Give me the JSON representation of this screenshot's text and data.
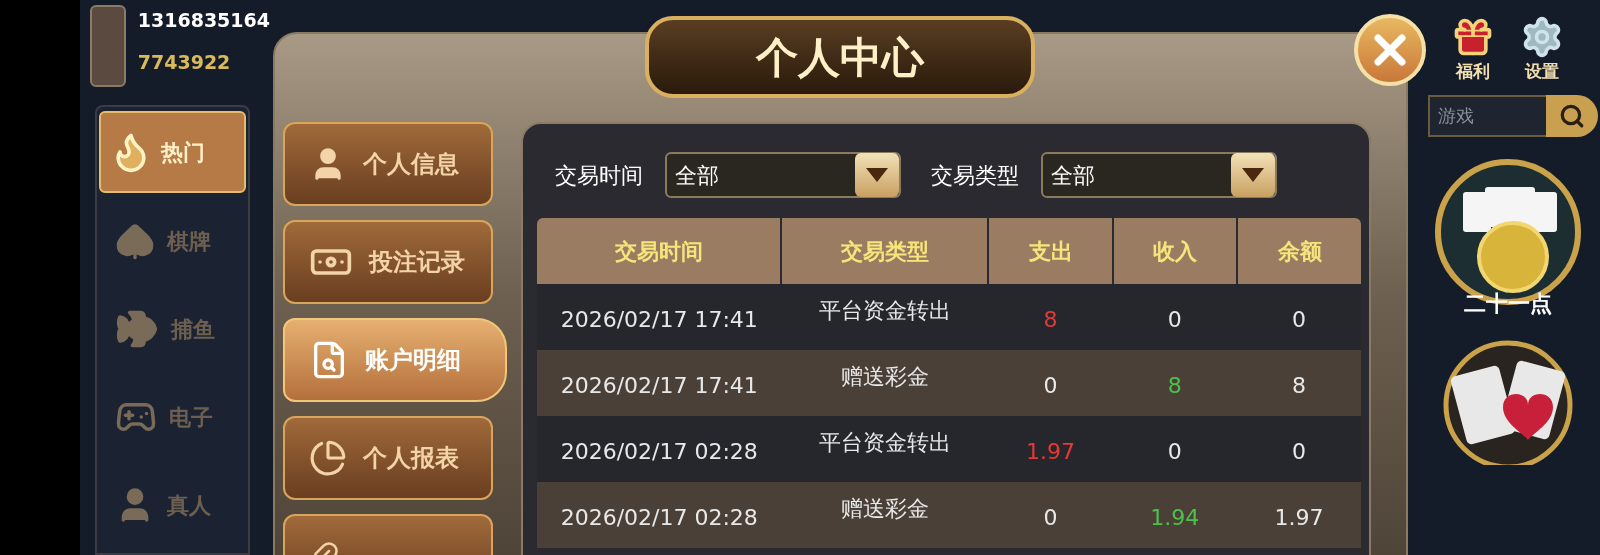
{
  "profile": {
    "phone": "1316835164",
    "balance": "7743922"
  },
  "categories": [
    {
      "label": "热门",
      "kind": "hot",
      "selected": true
    },
    {
      "label": "棋牌",
      "kind": "cards",
      "selected": false
    },
    {
      "label": "捕鱼",
      "kind": "fish",
      "selected": false
    },
    {
      "label": "电子",
      "kind": "slot",
      "selected": false
    },
    {
      "label": "真人",
      "kind": "live",
      "selected": false
    }
  ],
  "top_icons": [
    {
      "label": "福利",
      "kind": "gift"
    },
    {
      "label": "设置",
      "kind": "settings"
    }
  ],
  "search": {
    "placeholder": "游戏"
  },
  "games": [
    {
      "label": "二十一点",
      "kind": "blackjack"
    },
    {
      "kind": "redblack"
    }
  ],
  "dialog": {
    "title": "个人中心",
    "tabs": [
      {
        "label": "个人信息",
        "kind": "info",
        "selected": false
      },
      {
        "label": "投注记录",
        "kind": "bets",
        "selected": false
      },
      {
        "label": "账户明细",
        "kind": "account",
        "selected": true
      },
      {
        "label": "个人报表",
        "kind": "report",
        "selected": false
      },
      {
        "kind": "more",
        "selected": false
      }
    ],
    "filters": [
      {
        "label": "交易时间",
        "value": "全部"
      },
      {
        "label": "交易类型",
        "value": "全部"
      }
    ],
    "table": {
      "columns": [
        "交易时间",
        "交易类型",
        "支出",
        "收入",
        "余额"
      ],
      "rows": [
        {
          "time": "2026/02/17 17:41",
          "type": "平台资金转出",
          "expense": "8",
          "income": "0",
          "balance": "0",
          "kind": "out"
        },
        {
          "time": "2026/02/17 17:41",
          "type": "赠送彩金",
          "expense": "0",
          "income": "8",
          "balance": "8",
          "kind": "in"
        },
        {
          "time": "2026/02/17 02:28",
          "type": "平台资金转出",
          "expense": "1.97",
          "income": "0",
          "balance": "0",
          "kind": "out"
        },
        {
          "time": "2026/02/17 02:28",
          "type": "赠送彩金",
          "expense": "0",
          "income": "1.94",
          "balance": "1.97",
          "kind": "in"
        }
      ]
    }
  }
}
